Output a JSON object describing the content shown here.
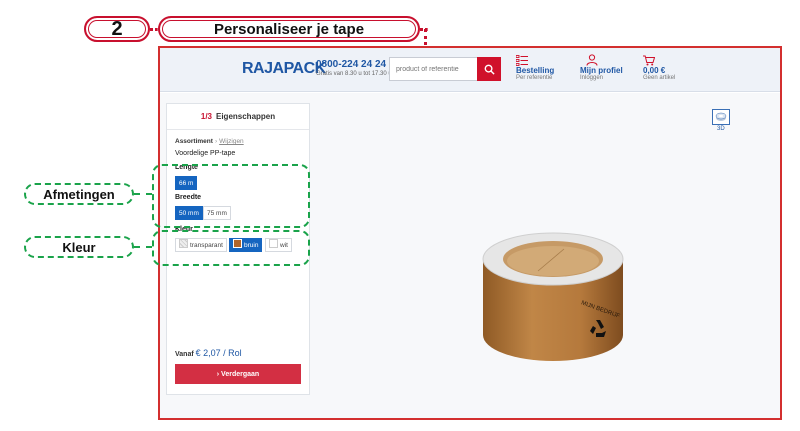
{
  "annotation": {
    "step_number": "2",
    "title": "Personaliseer je tape",
    "callout_dimensions": "Afmetingen",
    "callout_color": "Kleur"
  },
  "header": {
    "logo": "RAJAPACK",
    "phone": "0800-224 24 24",
    "phone_hours": "Gratis van 8.30 u tot 17.30 u",
    "search_placeholder": "product of referentie",
    "nav": [
      {
        "label": "Bestelling",
        "sub": "Per referentie",
        "icon": "list-icon"
      },
      {
        "label": "Mijn profiel",
        "sub": "Inloggen",
        "icon": "user-icon"
      },
      {
        "label": "0,00 €",
        "sub": "Geen artikel",
        "icon": "cart-icon"
      }
    ]
  },
  "panel": {
    "step": "1/3",
    "heading": "Eigenschappen",
    "breadcrumb_root": "Assortiment",
    "breadcrumb_action": "Wijzigen",
    "product": "Voordelige PP-tape",
    "length_label": "Lengte",
    "length_options": [
      "66 m"
    ],
    "length_selected": "66 m",
    "width_label": "Breedte",
    "width_options": [
      "50 mm",
      "75 mm"
    ],
    "width_selected": "50 mm",
    "color_label": "Kleur",
    "color_options": [
      {
        "name": "transparant",
        "color": "#e8e8e8"
      },
      {
        "name": "bruin",
        "color": "#b0652b"
      },
      {
        "name": "wit",
        "color": "#ffffff"
      }
    ],
    "color_selected": "bruin",
    "price_prefix": "Vanaf",
    "price": "€ 2,07 / Rol",
    "cta_label": "› Verdergaan"
  },
  "viewer": {
    "mode_label": "3D",
    "tape_text": "MIJN BEDRIJF",
    "tape_color": "#b77a3e"
  },
  "colors": {
    "accent_red": "#c8102e",
    "brand_blue": "#1f57a4",
    "callout_green": "#1aa34a",
    "selected_blue": "#1565c0"
  }
}
